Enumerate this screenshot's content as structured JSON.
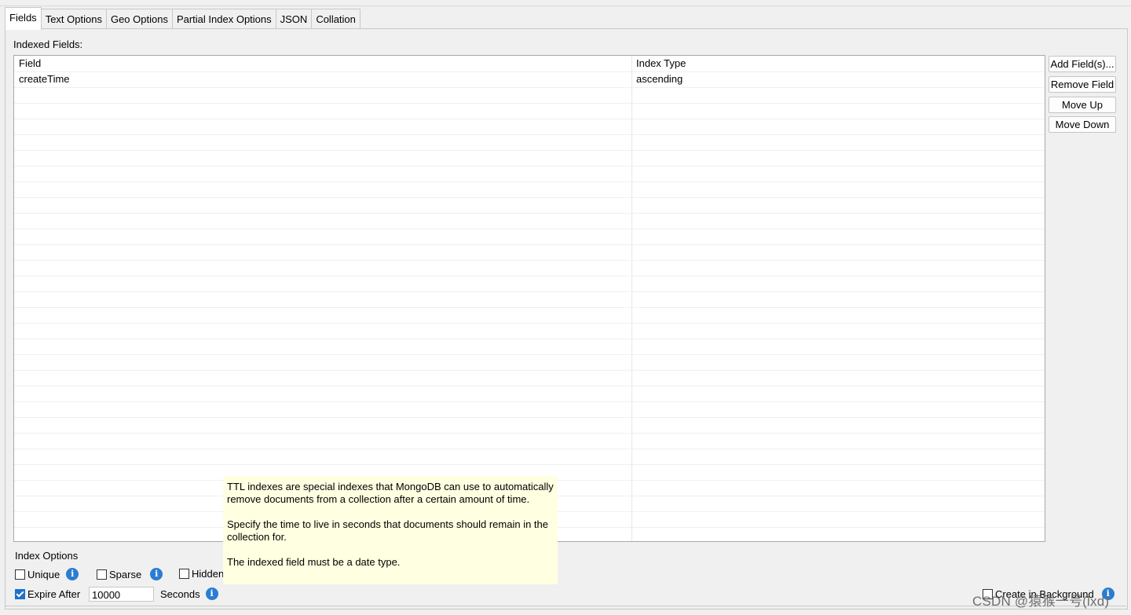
{
  "tabs": [
    {
      "label": "Fields",
      "active": true
    },
    {
      "label": "Text Options"
    },
    {
      "label": "Geo Options"
    },
    {
      "label": "Partial Index Options"
    },
    {
      "label": "JSON"
    },
    {
      "label": "Collation"
    }
  ],
  "fields_panel": {
    "indexed_fields_label": "Indexed Fields:",
    "columns": [
      "Field",
      "Index Type"
    ],
    "rows": [
      {
        "field": "createTime",
        "index_type": "ascending"
      }
    ]
  },
  "buttons": {
    "add_fields": "Add Field(s)...",
    "remove_field": "Remove Field",
    "move_up": "Move Up",
    "move_down": "Move Down"
  },
  "index_options": {
    "title": "Index Options",
    "unique": {
      "label": "Unique",
      "checked": false
    },
    "sparse": {
      "label": "Sparse",
      "checked": false
    },
    "hidden": {
      "label": "Hidden",
      "checked": false
    },
    "expire_after": {
      "label": "Expire After",
      "checked": true,
      "value": "10000",
      "unit": "Seconds"
    },
    "create_in_background": {
      "label": "Create in Background",
      "checked": false
    },
    "info_glyph": "i"
  },
  "tooltip": {
    "paragraph1": "TTL indexes are special indexes that MongoDB can use to automatically remove documents from a collection after a certain amount of time.",
    "paragraph2": "Specify the time to live in seconds that documents should remain in the collection for.",
    "paragraph3": "The indexed field must be a date type."
  },
  "watermark": "CSDN @猿猴一号(lxd)",
  "colors": {
    "accent": "#2a7dd1",
    "tooltip_bg": "#ffffe1",
    "panel_bg": "#f0f0f0"
  }
}
